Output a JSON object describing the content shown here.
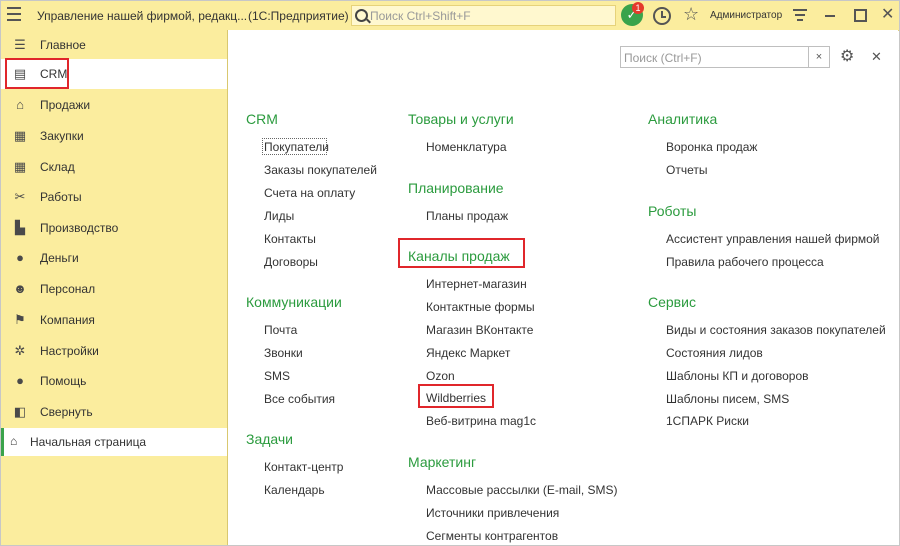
{
  "titlebar": {
    "title": "Управление нашей фирмой, редакц...",
    "platform": "(1С:Предприятие)",
    "search_placeholder": "Поиск Ctrl+Shift+F",
    "notification_count": "1",
    "user": "Администратор",
    "brand_color": "#fbed9e"
  },
  "sidebar": {
    "items": [
      {
        "label": "Главное",
        "icon": "menu-icon"
      },
      {
        "label": "CRM",
        "icon": "crm-card-icon"
      },
      {
        "label": "Продажи",
        "icon": "basket-icon"
      },
      {
        "label": "Закупки",
        "icon": "cart-icon"
      },
      {
        "label": "Склад",
        "icon": "warehouse-icon"
      },
      {
        "label": "Работы",
        "icon": "tools-icon"
      },
      {
        "label": "Производство",
        "icon": "factory-icon"
      },
      {
        "label": "Деньги",
        "icon": "money-icon"
      },
      {
        "label": "Персонал",
        "icon": "people-icon"
      },
      {
        "label": "Компания",
        "icon": "flag-icon"
      },
      {
        "label": "Настройки",
        "icon": "gear-icon"
      },
      {
        "label": "Помощь",
        "icon": "help-icon"
      },
      {
        "label": "Свернуть",
        "icon": "collapse-icon"
      }
    ],
    "home": "Начальная страница"
  },
  "main": {
    "search_placeholder": "Поиск (Ctrl+F)",
    "accent_color": "#2b9b3e",
    "highlight_color": "#e0262b",
    "col1": {
      "crm": {
        "title": "CRM",
        "links": [
          "Покупатели",
          "Заказы покупателей",
          "Счета на оплату",
          "Лиды",
          "Контакты",
          "Договоры"
        ]
      },
      "comm": {
        "title": "Коммуникации",
        "links": [
          "Почта",
          "Звонки",
          "SMS",
          "Все события"
        ]
      },
      "tasks": {
        "title": "Задачи",
        "links": [
          "Контакт-центр",
          "Календарь"
        ]
      }
    },
    "col2": {
      "goods": {
        "title": "Товары и услуги",
        "links": [
          "Номенклатура"
        ]
      },
      "plan": {
        "title": "Планирование",
        "links": [
          "Планы продаж"
        ]
      },
      "channels": {
        "title": "Каналы продаж",
        "links": [
          "Интернет-магазин",
          "Контактные формы",
          "Магазин ВКонтакте",
          "Яндекс Маркет",
          "Ozon",
          "Wildberries",
          "Веб-витрина mag1c"
        ]
      },
      "marketing": {
        "title": "Маркетинг",
        "links": [
          "Массовые рассылки (E-mail, SMS)",
          "Источники привлечения",
          "Сегменты контрагентов"
        ]
      }
    },
    "col3": {
      "analytics": {
        "title": "Аналитика",
        "links": [
          "Воронка продаж",
          "Отчеты"
        ]
      },
      "robots": {
        "title": "Роботы",
        "links": [
          "Ассистент управления нашей фирмой",
          "Правила рабочего процесса"
        ]
      },
      "service": {
        "title": "Сервис",
        "links": [
          "Виды и состояния заказов покупателей",
          "Состояния лидов",
          "Шаблоны КП и договоров",
          "Шаблоны писем, SMS",
          "1СПАРК Риски"
        ]
      }
    }
  }
}
